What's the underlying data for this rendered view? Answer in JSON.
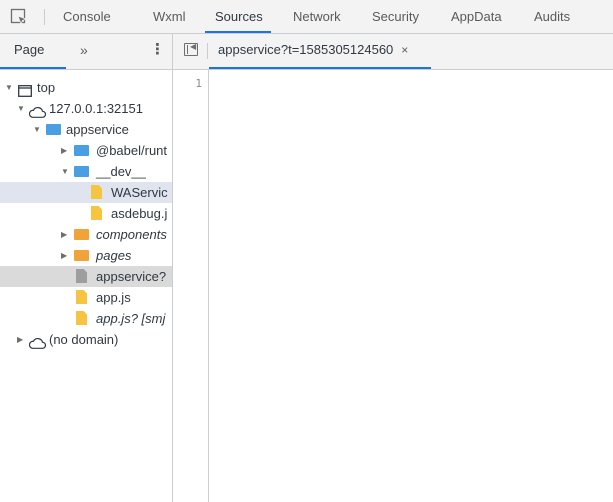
{
  "top_tabs": [
    {
      "label": "Console"
    },
    {
      "label": "Wxml"
    },
    {
      "label": "Sources"
    },
    {
      "label": "Network"
    },
    {
      "label": "Security"
    },
    {
      "label": "AppData"
    },
    {
      "label": "Audits"
    }
  ],
  "active_top_tab": "Sources",
  "sidebar": {
    "tab_label": "Page",
    "more_label": "»",
    "menu_label": "⋮",
    "tree": [
      {
        "label": "top",
        "type": "frame",
        "expanded": true
      },
      {
        "label": "127.0.0.1:32151",
        "type": "cloud",
        "expanded": true
      },
      {
        "label": "appservice",
        "type": "folder-blue",
        "expanded": true
      },
      {
        "label": "@babel/runt",
        "type": "folder-blue",
        "expanded": false
      },
      {
        "label": "__dev__",
        "type": "folder-blue",
        "expanded": true
      },
      {
        "label": "WAServic",
        "type": "file-yellow",
        "selected": true
      },
      {
        "label": "asdebug.j",
        "type": "file-yellow"
      },
      {
        "label": "components",
        "type": "folder-orange",
        "expanded": false,
        "italic": true
      },
      {
        "label": "pages",
        "type": "folder-orange",
        "expanded": false,
        "italic": true
      },
      {
        "label": "appservice?",
        "type": "file-gray",
        "active": true
      },
      {
        "label": "app.js",
        "type": "file-yellow"
      },
      {
        "label": "app.js? [smj",
        "type": "file-yellow",
        "italic": true
      },
      {
        "label": "(no domain)",
        "type": "cloud",
        "expanded": false
      }
    ]
  },
  "editor": {
    "file_tab_label": "appservice?t=1585305124560",
    "close_label": "×",
    "line_numbers": [
      "1"
    ]
  },
  "colors": {
    "accent": "#1a73e8",
    "folder_blue": "#4a9fe3",
    "folder_orange": "#f0a338",
    "file_yellow": "#f5c542",
    "file_gray": "#9e9e9e"
  }
}
